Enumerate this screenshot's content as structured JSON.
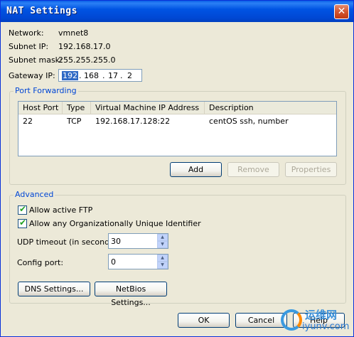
{
  "window": {
    "title": "NAT Settings",
    "close_glyph": "✕"
  },
  "info": {
    "network_label": "Network:",
    "network_value": "vmnet8",
    "subnet_ip_label": "Subnet IP:",
    "subnet_ip_value": "192.168.17.0",
    "subnet_mask_label": "Subnet mask:",
    "subnet_mask_value": "255.255.255.0",
    "gateway_label": "Gateway IP:",
    "gateway_segments": [
      "192",
      "168",
      "17",
      "2"
    ]
  },
  "port_forwarding": {
    "title": "Port Forwarding",
    "columns": [
      "Host Port",
      "Type",
      "Virtual Machine IP Address",
      "Description"
    ],
    "rows": [
      {
        "host_port": "22",
        "type": "TCP",
        "vm_ip": "192.168.17.128:22",
        "description": "centOS ssh, number"
      }
    ],
    "add_label": "Add",
    "remove_label": "Remove",
    "properties_label": "Properties"
  },
  "advanced": {
    "title": "Advanced",
    "allow_ftp_label": "Allow active FTP",
    "allow_ftp_checked": true,
    "allow_oui_label": "Allow any Organizationally Unique Identifier",
    "allow_oui_checked": true,
    "udp_label": "UDP timeout (in seconds):",
    "udp_value": "30",
    "config_port_label": "Config port:",
    "config_port_value": "0",
    "dns_label": "DNS Settings...",
    "netbios_label": "NetBios Settings..."
  },
  "footer": {
    "ok_label": "OK",
    "cancel_label": "Cancel",
    "help_label": "Help"
  },
  "watermark": {
    "line1": "运维网",
    "line2": "iyunv.com"
  }
}
